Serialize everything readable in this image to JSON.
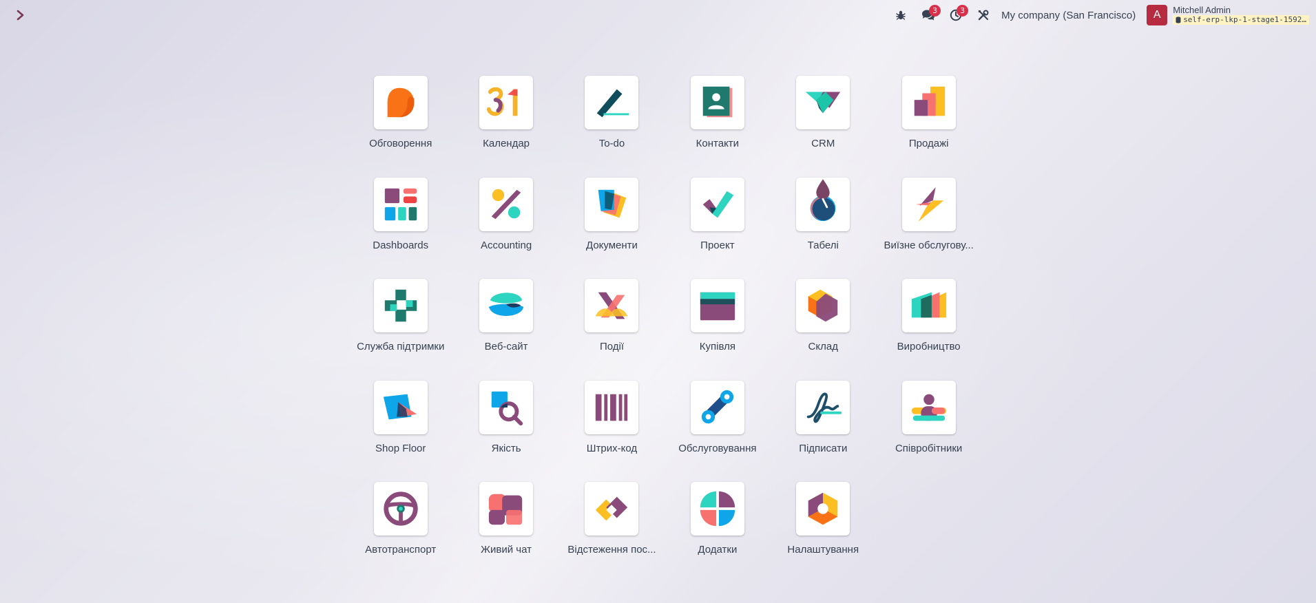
{
  "topbar": {
    "notifications": {
      "messages_count": "3",
      "activities_count": "3"
    },
    "company": "My company (San Francisco)",
    "user": {
      "avatar_letter": "A",
      "name": "Mitchell Admin",
      "database": "self-erp-lkp-1-stage1-1592…"
    }
  },
  "apps": [
    {
      "label": "Обговорення",
      "icon": "discuss-icon"
    },
    {
      "label": "Календар",
      "icon": "calendar-icon"
    },
    {
      "label": "To-do",
      "icon": "todo-icon"
    },
    {
      "label": "Контакти",
      "icon": "contacts-icon"
    },
    {
      "label": "CRM",
      "icon": "crm-icon"
    },
    {
      "label": "Продажі",
      "icon": "sales-icon"
    },
    {
      "label": "Dashboards",
      "icon": "dashboards-icon"
    },
    {
      "label": "Accounting",
      "icon": "accounting-icon"
    },
    {
      "label": "Документи",
      "icon": "documents-icon"
    },
    {
      "label": "Проект",
      "icon": "project-icon"
    },
    {
      "label": "Табелі",
      "icon": "timesheets-icon"
    },
    {
      "label": "Виїзне обслугову...",
      "icon": "field-service-icon"
    },
    {
      "label": "Служба підтримки",
      "icon": "helpdesk-icon"
    },
    {
      "label": "Веб-сайт",
      "icon": "website-icon"
    },
    {
      "label": "Події",
      "icon": "events-icon"
    },
    {
      "label": "Купівля",
      "icon": "purchase-icon"
    },
    {
      "label": "Склад",
      "icon": "inventory-icon"
    },
    {
      "label": "Виробництво",
      "icon": "manufacturing-icon"
    },
    {
      "label": "Shop Floor",
      "icon": "shop-floor-icon"
    },
    {
      "label": "Якість",
      "icon": "quality-icon"
    },
    {
      "label": "Штрих-код",
      "icon": "barcode-icon"
    },
    {
      "label": "Обслуговування",
      "icon": "maintenance-icon"
    },
    {
      "label": "Підписати",
      "icon": "sign-icon"
    },
    {
      "label": "Співробітники",
      "icon": "employees-icon"
    },
    {
      "label": "Автотранспорт",
      "icon": "fleet-icon"
    },
    {
      "label": "Живий чат",
      "icon": "live-chat-icon"
    },
    {
      "label": "Відстеження пос...",
      "icon": "link-tracker-icon"
    },
    {
      "label": "Додатки",
      "icon": "apps-icon"
    },
    {
      "label": "Налаштування",
      "icon": "settings-icon"
    }
  ]
}
